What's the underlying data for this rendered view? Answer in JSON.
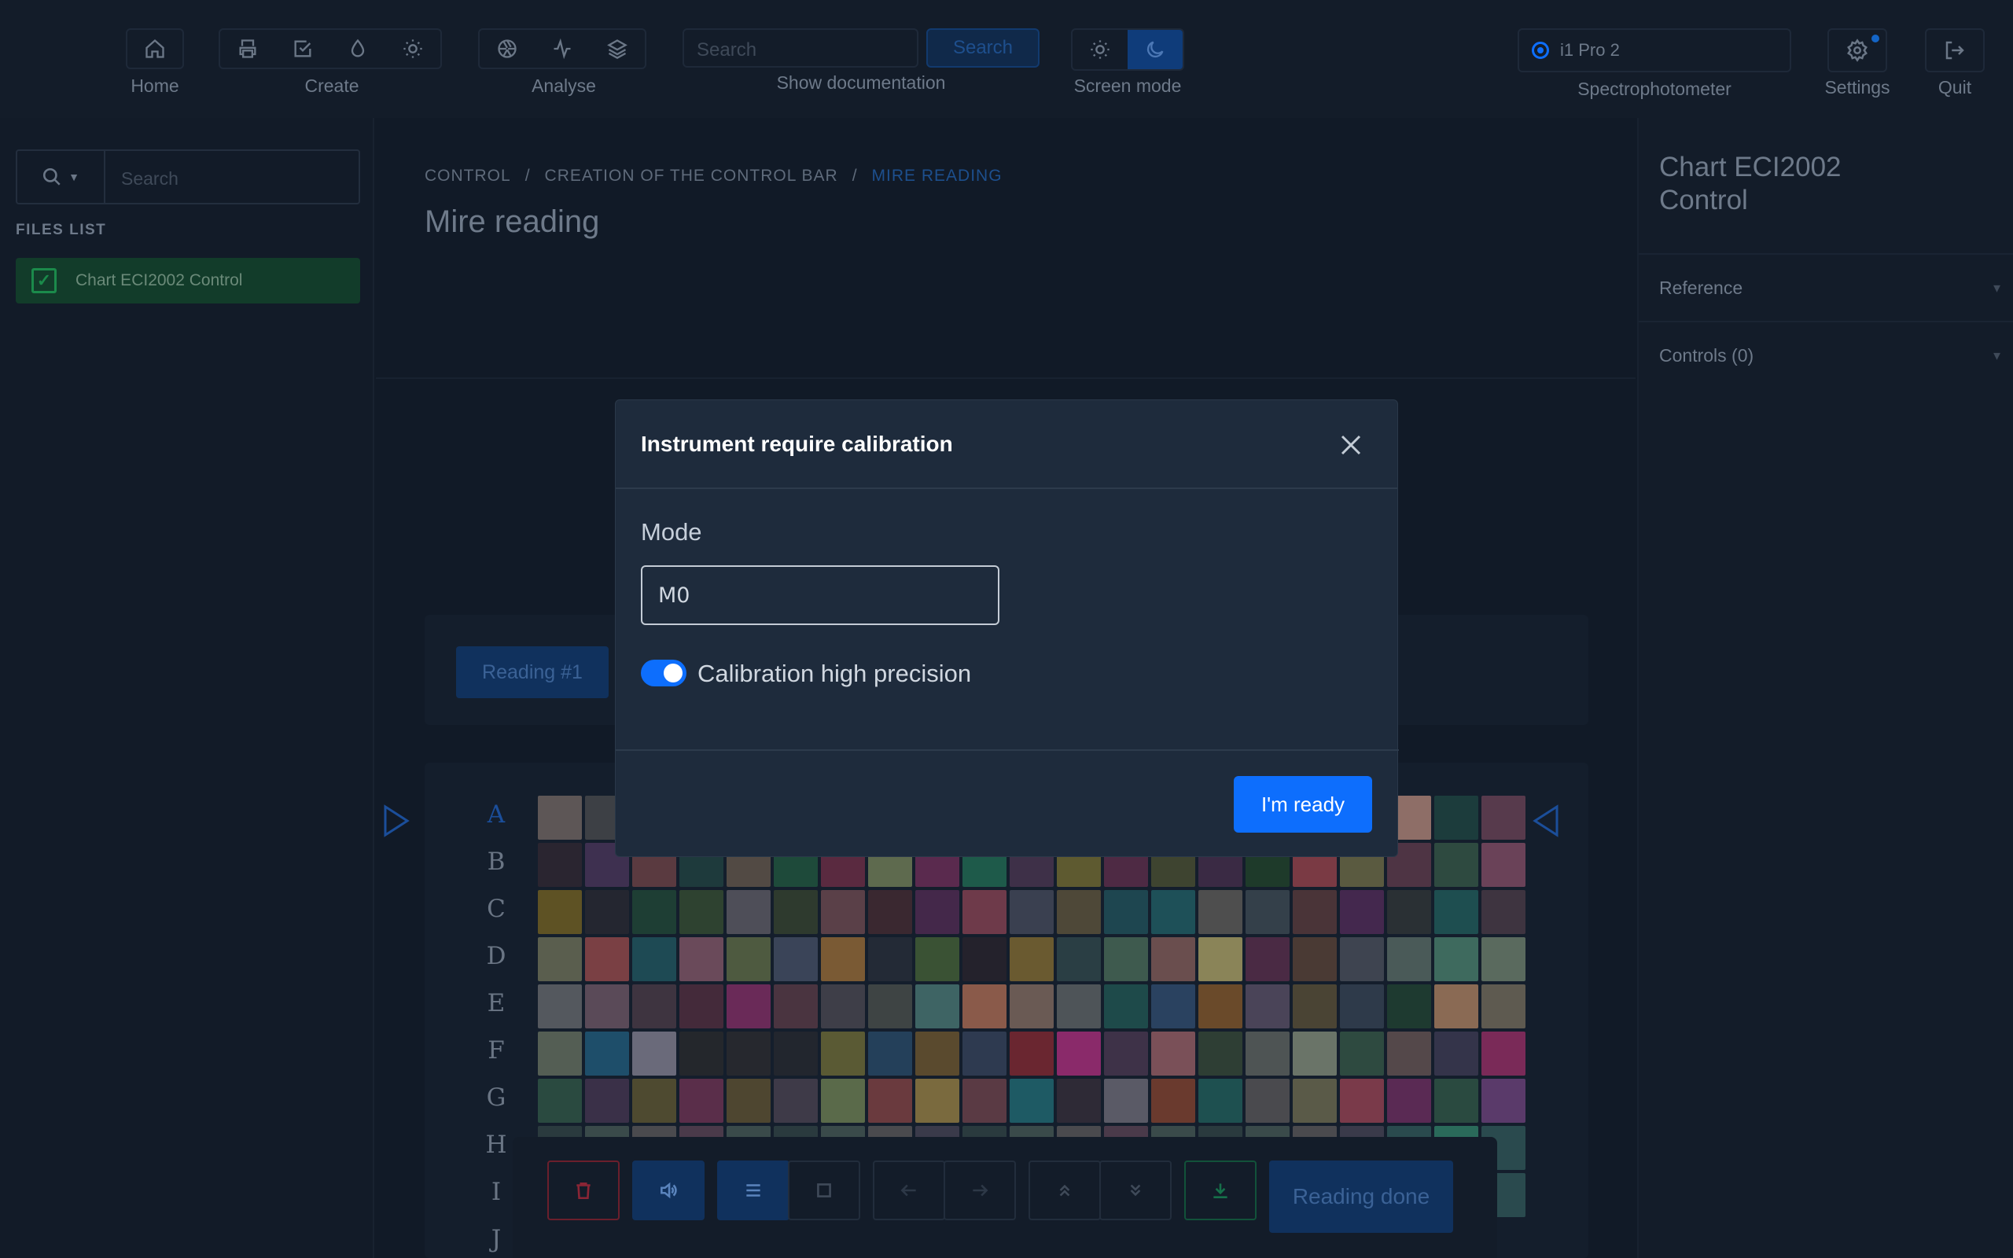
{
  "topbar": {
    "groups": {
      "home": "Home",
      "create": "Create",
      "analyse": "Analyse",
      "docs": "Show documentation",
      "screen_mode": "Screen mode",
      "spectro": "Spectrophotometer",
      "settings": "Settings",
      "quit": "Quit"
    },
    "search_placeholder": "Search",
    "search_button": "Search",
    "instrument": "i1 Pro 2"
  },
  "sidebar": {
    "search_placeholder": "Search",
    "files_title": "FILES LIST",
    "files": [
      {
        "label": "Chart ECI2002 Control",
        "checked": true
      }
    ]
  },
  "main": {
    "breadcrumb": [
      "CONTROL",
      "CREATION OF THE CONTROL BAR",
      "MIRE READING"
    ],
    "title": "Mire reading",
    "reading_tab": "Reading #1",
    "rows": [
      "A",
      "B",
      "C",
      "D",
      "E",
      "F",
      "G",
      "H",
      "I",
      "J"
    ],
    "active_row": "A",
    "reading_done": "Reading done"
  },
  "right_panel": {
    "title": "Chart ECI2002 Control",
    "sections": [
      "Reference",
      "Controls (0)"
    ]
  },
  "modal": {
    "title": "Instrument require calibration",
    "mode_label": "Mode",
    "mode_value": "M0",
    "toggle_label": "Calibration high precision",
    "toggle_on": true,
    "ready_button": "I'm ready"
  },
  "colors": {
    "accent": "#0d6efd",
    "window_close": "#ff5f57",
    "window_min": "#febc2e",
    "window_max": "#28c840",
    "success": "#1b8a4b",
    "danger": "#b3263b"
  }
}
